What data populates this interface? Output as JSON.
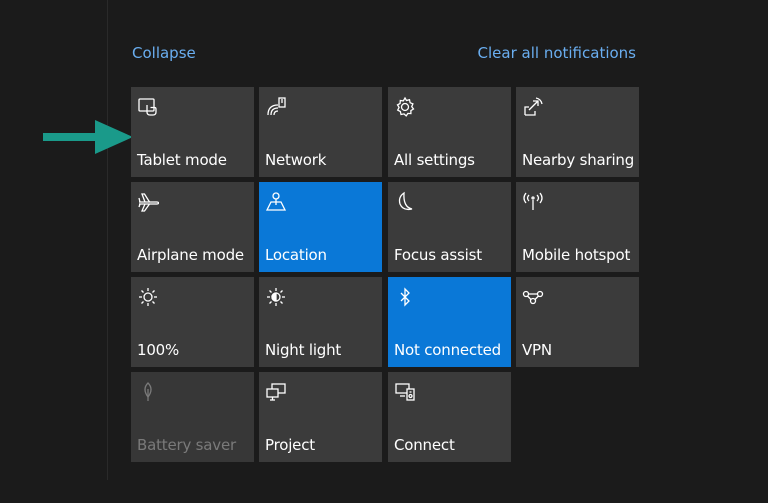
{
  "header": {
    "collapse_label": "Collapse",
    "clear_label": "Clear all notifications"
  },
  "colors": {
    "accent": "#0a78d7",
    "link": "#6aaef0",
    "arrow": "#1a9a8a",
    "tile": "#3b3b3b"
  },
  "tiles": [
    {
      "label": "Tablet mode",
      "icon": "tablet-mode-icon",
      "state": "off"
    },
    {
      "label": "Network",
      "icon": "network-icon",
      "state": "off"
    },
    {
      "label": "All settings",
      "icon": "gear-icon",
      "state": "off"
    },
    {
      "label": "Nearby sharing",
      "icon": "nearby-sharing-icon",
      "state": "off"
    },
    {
      "label": "Airplane mode",
      "icon": "airplane-icon",
      "state": "off"
    },
    {
      "label": "Location",
      "icon": "location-icon",
      "state": "on"
    },
    {
      "label": "Focus assist",
      "icon": "moon-icon",
      "state": "off"
    },
    {
      "label": "Mobile hotspot",
      "icon": "hotspot-icon",
      "state": "off"
    },
    {
      "label": "100%",
      "icon": "brightness-icon",
      "state": "off"
    },
    {
      "label": "Night light",
      "icon": "night-light-icon",
      "state": "off"
    },
    {
      "label": "Not connected",
      "icon": "bluetooth-icon",
      "state": "on"
    },
    {
      "label": "VPN",
      "icon": "vpn-icon",
      "state": "off"
    },
    {
      "label": "Battery saver",
      "icon": "battery-saver-icon",
      "state": "disabled"
    },
    {
      "label": "Project",
      "icon": "project-icon",
      "state": "off"
    },
    {
      "label": "Connect",
      "icon": "connect-icon",
      "state": "off"
    }
  ]
}
